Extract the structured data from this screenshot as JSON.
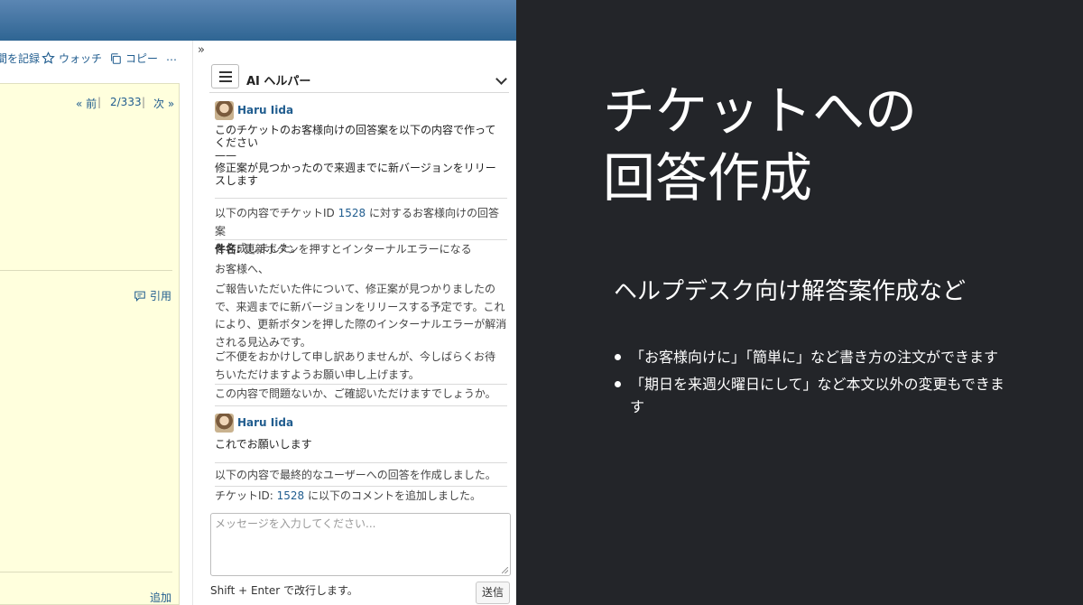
{
  "screenshot": {
    "actions": {
      "record_label": "間を記録",
      "watch_label": "ウォッチ",
      "copy_label": "コピー",
      "more_label": "…"
    },
    "ticket_nav": {
      "prev_label": "« 前",
      "position": "2/333",
      "next_label": "次 »"
    },
    "quote_label": "引用",
    "add_label": "追加",
    "expand_icon": "»",
    "ai_panel": {
      "title": "AI ヘルパー",
      "conversation": [
        {
          "role": "user",
          "name": "Haru Iida",
          "lines": [
            "このチケットのお客様向けの回答案を以下の内容で作って",
            "ください",
            "——",
            "修正案が見つかったので来週までに新バージョンをリリー",
            "スします"
          ]
        },
        {
          "role": "assistant",
          "intro_before": "以下の内容でチケットID ",
          "ticket_id": "1528",
          "intro_after": " に対するお客様向けの回答案",
          "intro_line2": "を作成しました。",
          "subject_label": "件名:",
          "subject_text": " 更新ボタンを押すとインターナルエラーになる",
          "greeting": "お客様へ、",
          "body_lines": [
            "ご報告いただいた件について、修正案が見つかりましたの",
            "で、来週までに新バージョンをリリースする予定です。これ",
            "により、更新ボタンを押した際のインターナルエラーが解消",
            "される見込みです。"
          ],
          "apology_lines": [
            "ご不便をおかけして申し訳ありませんが、今しばらくお待",
            "ちいただけますようお願い申し上げます。"
          ],
          "confirm": "この内容で問題ないか、ご確認いただけますでしょうか。"
        },
        {
          "role": "user",
          "name": "Haru Iida",
          "text": "これでお願いします"
        },
        {
          "role": "assistant",
          "final_text": "以下の内容で最終的なユーザーへの回答を作成しました。",
          "comment_before": "チケットID: ",
          "ticket_id": "1528",
          "comment_after": " に以下のコメントを追加しました。"
        }
      ],
      "input_placeholder": "メッセージを入力してください...",
      "hint": "Shift + Enter で改行します。",
      "send_label": "送信"
    }
  },
  "slide": {
    "title_line1": "チケットへの",
    "title_line2": "回答作成",
    "subtitle": "ヘルプデスク向け解答案作成など",
    "bullets": [
      "「お客様向けに」「簡単に」など書き方の注文ができます",
      "「期日を来週火曜日にして」など本文以外の変更もできます"
    ]
  },
  "colors": {
    "slide_bg": "#232529",
    "link": "#215d8f",
    "ticket_bg": "#ffffdd",
    "header_gradient_top": "#5b86b3",
    "header_gradient_bottom": "#2f6593"
  }
}
